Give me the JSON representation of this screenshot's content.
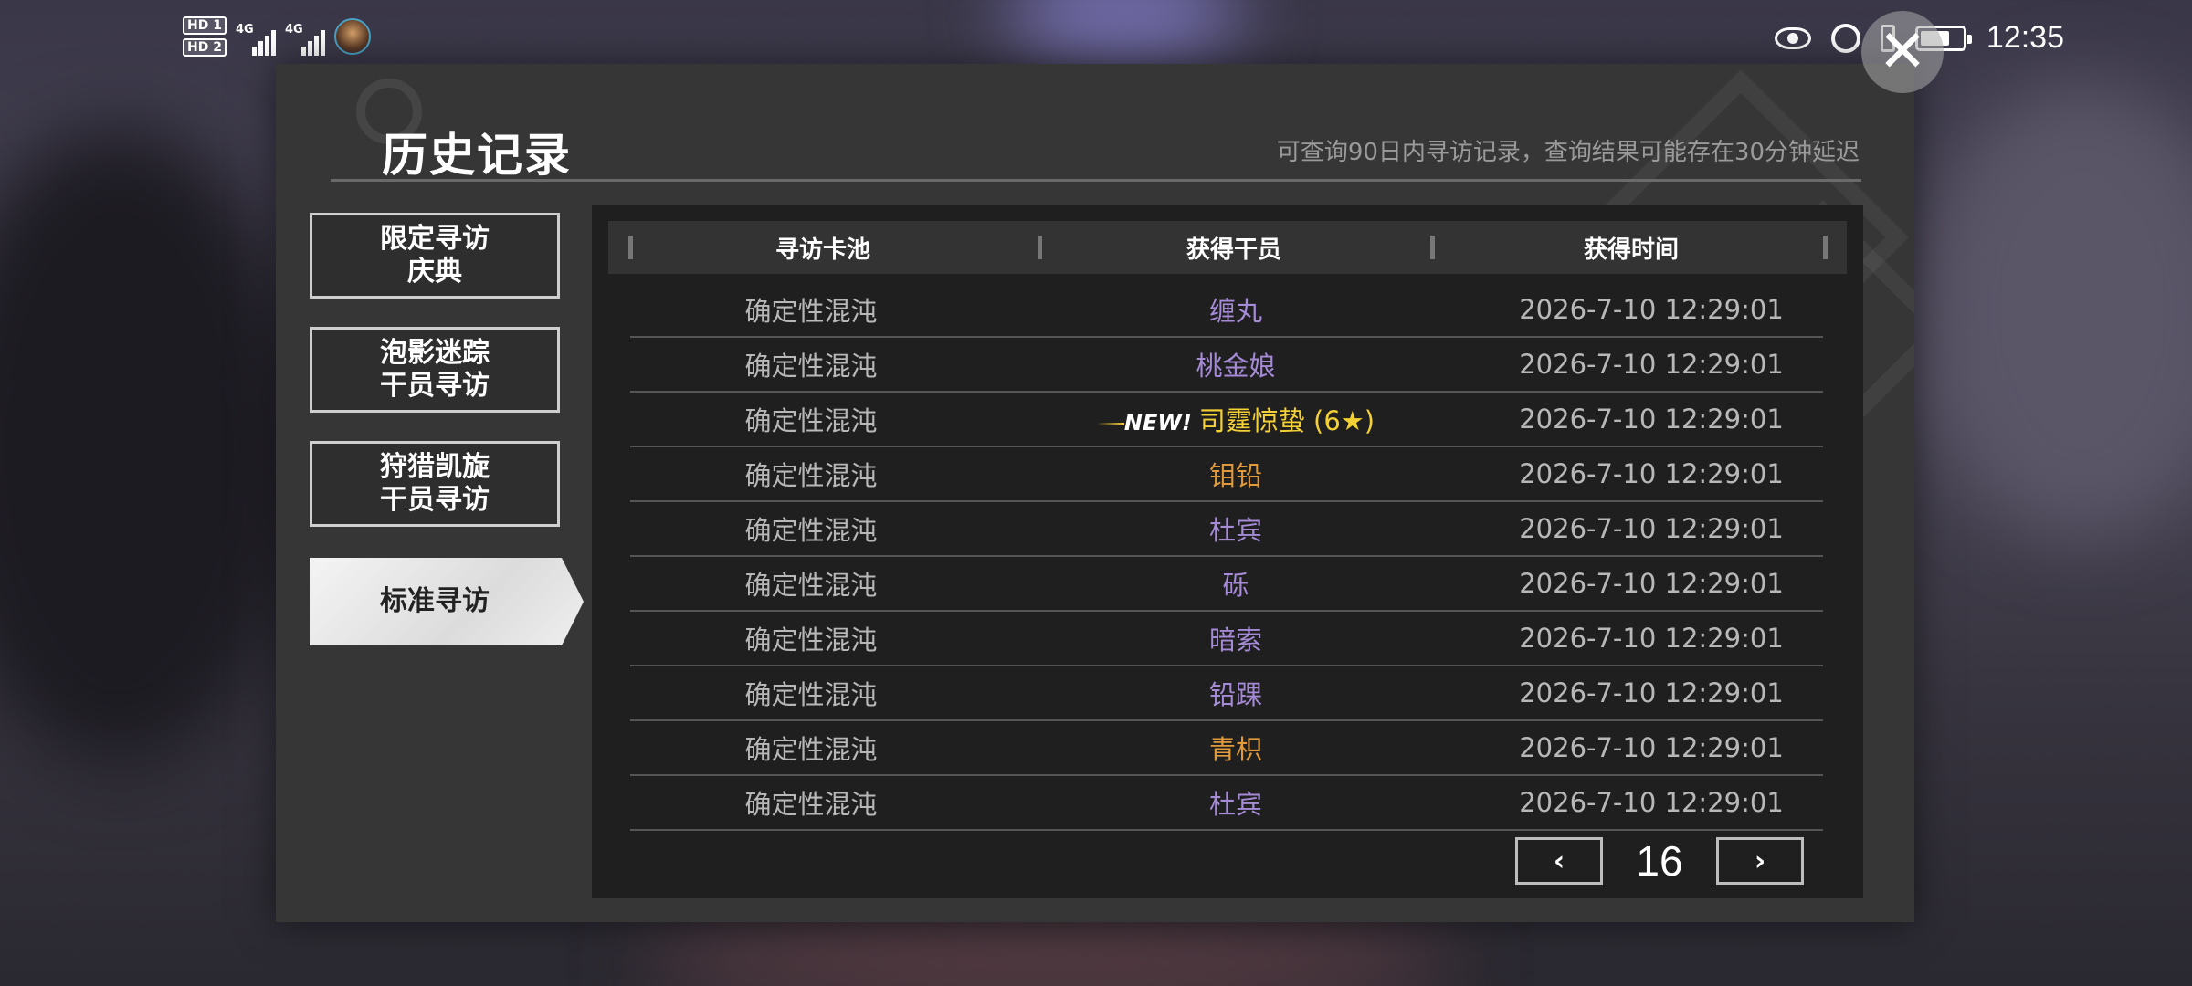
{
  "statusbar": {
    "sim1": "HD 1",
    "sim2": "HD 2",
    "net1": "4G",
    "net2": "4G",
    "time": "12:35",
    "icons": [
      "eye-icon",
      "alarm-icon",
      "vibrate-icon",
      "battery-icon"
    ]
  },
  "header": {
    "title": "历史记录",
    "subtitle": "可查询90日内寻访记录，查询结果可能存在30分钟延迟",
    "close_label": "✕"
  },
  "menu": {
    "items": [
      {
        "label_line1": "限定寻访",
        "label_line2": "庆典",
        "active": false
      },
      {
        "label_line1": "泡影迷踪",
        "label_line2": "干员寻访",
        "active": false
      },
      {
        "label_line1": "狩猎凯旋",
        "label_line2": "干员寻访",
        "active": false
      },
      {
        "label_line1": "标准寻访",
        "label_line2": "",
        "active": true
      }
    ]
  },
  "table": {
    "columns": [
      "寻访卡池",
      "获得干员",
      "获得时间"
    ],
    "rows": [
      {
        "pool": "确定性混沌",
        "operator": "缠丸",
        "time": "2026-7-10 12:29:01",
        "rarity": 4
      },
      {
        "pool": "确定性混沌",
        "operator": "桃金娘",
        "time": "2026-7-10 12:29:01",
        "rarity": 4
      },
      {
        "pool": "确定性混沌",
        "operator": "司霆惊蛰 (6★)",
        "time": "2026-7-10 12:29:01",
        "rarity": 6,
        "new_label": "NEW!"
      },
      {
        "pool": "确定性混沌",
        "operator": "钼铅",
        "time": "2026-7-10 12:29:01",
        "rarity": 5
      },
      {
        "pool": "确定性混沌",
        "operator": "杜宾",
        "time": "2026-7-10 12:29:01",
        "rarity": 4
      },
      {
        "pool": "确定性混沌",
        "operator": "砾",
        "time": "2026-7-10 12:29:01",
        "rarity": 4
      },
      {
        "pool": "确定性混沌",
        "operator": "暗索",
        "time": "2026-7-10 12:29:01",
        "rarity": 4
      },
      {
        "pool": "确定性混沌",
        "operator": "铅踝",
        "time": "2026-7-10 12:29:01",
        "rarity": 4
      },
      {
        "pool": "确定性混沌",
        "operator": "青枳",
        "time": "2026-7-10 12:29:01",
        "rarity": 5
      },
      {
        "pool": "确定性混沌",
        "operator": "杜宾",
        "time": "2026-7-10 12:29:01",
        "rarity": 4
      }
    ]
  },
  "pager": {
    "prev_label": "‹",
    "next_label": "›",
    "page": "16"
  },
  "colors": {
    "rarity4": "#a58ad6",
    "rarity5": "#e09a3a",
    "rarity6": "#f3d034"
  }
}
